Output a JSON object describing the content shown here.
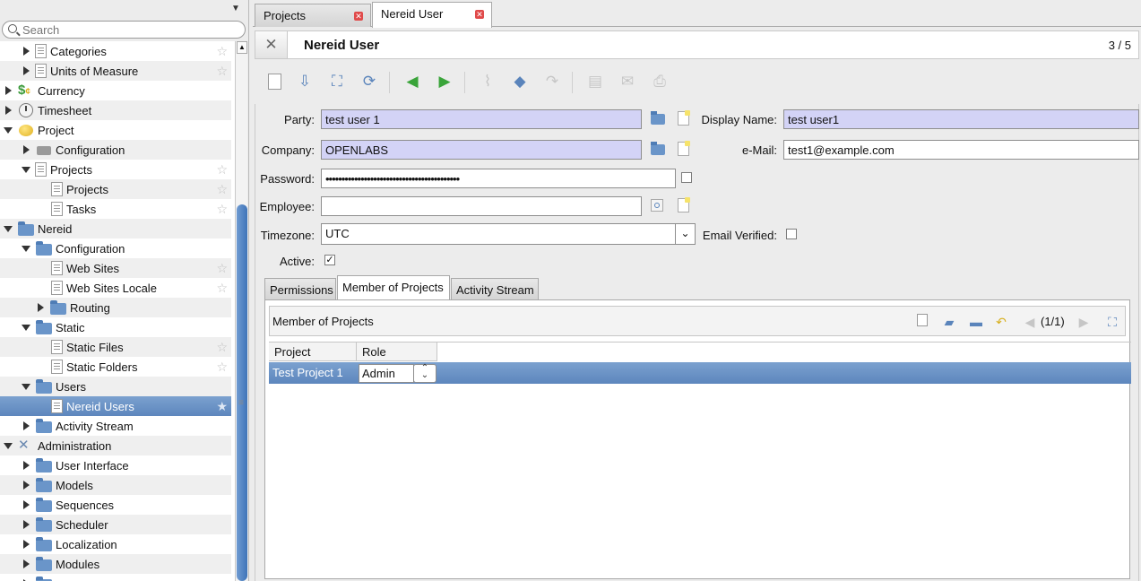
{
  "sidebar": {
    "search_placeholder": "Search",
    "items": [
      {
        "label": "Categories"
      },
      {
        "label": "Units of Measure"
      },
      {
        "label": "Currency"
      },
      {
        "label": "Timesheet"
      },
      {
        "label": "Project"
      },
      {
        "label": "Configuration"
      },
      {
        "label": "Projects"
      },
      {
        "label": "Projects"
      },
      {
        "label": "Tasks"
      },
      {
        "label": "Nereid"
      },
      {
        "label": "Configuration"
      },
      {
        "label": "Web Sites"
      },
      {
        "label": "Web Sites Locale"
      },
      {
        "label": "Routing"
      },
      {
        "label": "Static"
      },
      {
        "label": "Static Files"
      },
      {
        "label": "Static Folders"
      },
      {
        "label": "Users"
      },
      {
        "label": "Nereid Users"
      },
      {
        "label": "Activity Stream"
      },
      {
        "label": "Administration"
      },
      {
        "label": "User Interface"
      },
      {
        "label": "Models"
      },
      {
        "label": "Sequences"
      },
      {
        "label": "Scheduler"
      },
      {
        "label": "Localization"
      },
      {
        "label": "Modules"
      }
    ]
  },
  "tabs": [
    {
      "label": "Projects"
    },
    {
      "label": "Nereid User"
    }
  ],
  "header": {
    "title": "Nereid User",
    "pager": "3 / 5"
  },
  "form": {
    "party": {
      "label": "Party:",
      "value": "test user 1"
    },
    "display_name": {
      "label": "Display Name:",
      "value": "test user1"
    },
    "company": {
      "label": "Company:",
      "value": "OPENLABS"
    },
    "email": {
      "label": "e-Mail:",
      "value": "test1@example.com"
    },
    "password": {
      "label": "Password:",
      "value": "••••••••••••••••••••••••••••••••••••••••••"
    },
    "employee": {
      "label": "Employee:",
      "value": ""
    },
    "timezone": {
      "label": "Timezone:",
      "value": "UTC"
    },
    "email_verified": {
      "label": "Email Verified:",
      "checked": false
    },
    "active": {
      "label": "Active:",
      "checked": true
    }
  },
  "subtabs": [
    {
      "label": "Permissions"
    },
    {
      "label": "Member of Projects"
    },
    {
      "label": "Activity Stream"
    }
  ],
  "subpanel": {
    "title": "Member of Projects",
    "pager": "(1/1)",
    "columns": [
      "Project",
      "Role"
    ],
    "rows": [
      {
        "project": "Test Project 1",
        "role": "Admin"
      }
    ]
  }
}
